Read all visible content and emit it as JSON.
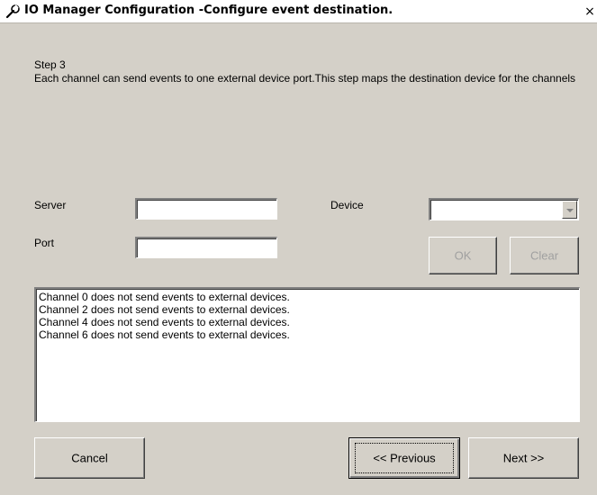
{
  "window": {
    "title": "IO Manager Configuration -Configure event destination.",
    "icon": "wrench-icon",
    "close_glyph": "×"
  },
  "step": {
    "label": "Step 3",
    "description": "Each channel can send events to one external device port.This step maps the destination device for the channels"
  },
  "form": {
    "server_label": "Server",
    "server_value": "",
    "port_label": "Port",
    "port_value": "",
    "device_label": "Device",
    "device_value": ""
  },
  "buttons": {
    "ok": "OK",
    "clear": "Clear",
    "cancel": "Cancel",
    "previous": "<< Previous",
    "next": "Next >>"
  },
  "channels": [
    "Channel 0 does not send events to external devices.",
    "Channel 2 does not send events to external devices.",
    "Channel 4 does not send events to external devices.",
    "Channel 6 does not send events to external devices."
  ],
  "colors": {
    "dialog_bg": "#d4d0c8",
    "disabled_text": "#a0a0a0"
  }
}
